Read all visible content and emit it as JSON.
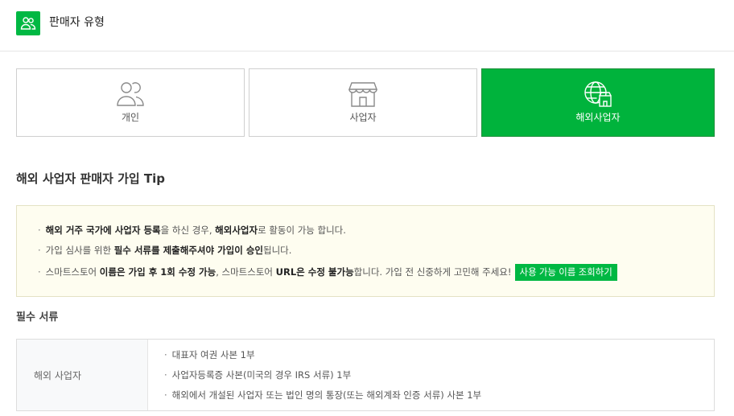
{
  "header": {
    "title": "판매자 유형",
    "icon": "users-icon"
  },
  "seller_types": [
    {
      "label": "개인",
      "icon": "person-icon",
      "selected": false
    },
    {
      "label": "사업자",
      "icon": "storefront-icon",
      "selected": false
    },
    {
      "label": "해외사업자",
      "icon": "globe-store-icon",
      "selected": true
    }
  ],
  "tip": {
    "title": "해외 사업자 판매자 가입 Tip",
    "line1": {
      "b1": "해외 거주 국가에 사업자 등록",
      "t1": "을 하신 경우, ",
      "b2": "해외사업자",
      "t2": "로 활동이 가능 합니다."
    },
    "line2": {
      "t0": "가입 심사를 위한 ",
      "b1": "필수 서류를 제출해주셔야 가입이 승인",
      "t1": "됩니다."
    },
    "line3": {
      "t0": "스마트스토어 ",
      "b1": "이름은 가입 후 1회 수정 가능",
      "t1": ", 스마트스토어 ",
      "b2": "URL은 수정 불가능",
      "t2": "합니다. 가입 전 신중하게 고민해 주세요!"
    },
    "button_label": "사용 가능 이름 조회하기"
  },
  "required_docs": {
    "title": "필수 서류",
    "category_label": "해외 사업자",
    "items": [
      "대표자 여권 사본 1부",
      "사업자등록증 사본(미국의 경우 IRS 서류) 1부",
      "해외에서 개설된 사업자 또는 법인 명의 통장(또는 해외계좌 인증 서류) 사본 1부"
    ]
  },
  "bullet": "·",
  "colors": {
    "accent": "#00b843",
    "selected_card": "#00b33c",
    "tip_background": "#fefdf0"
  }
}
